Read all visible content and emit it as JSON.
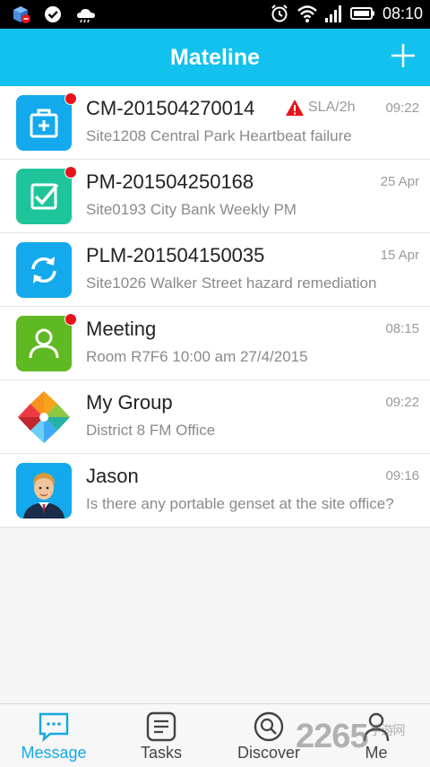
{
  "status_bar": {
    "time": "08:10"
  },
  "header": {
    "title": "Mateline",
    "add_icon": "plus-icon"
  },
  "conversations": [
    {
      "name": "CM-201504270014",
      "subtitle": "Site1208 Central Park Heartbeat failure",
      "time": "09:22",
      "sla": "SLA/2h",
      "unread": true,
      "icon": "toolbox-icon",
      "color": "#13a9ec"
    },
    {
      "name": "PM-201504250168",
      "subtitle": "Site0193 City Bank Weekly PM",
      "time": "25 Apr",
      "unread": true,
      "icon": "checkbox-icon",
      "color": "#1fc59a"
    },
    {
      "name": "PLM-201504150035",
      "subtitle": "Site1026 Walker Street hazard remediation",
      "time": "15 Apr",
      "unread": false,
      "icon": "refresh-icon",
      "color": "#13a9ec"
    },
    {
      "name": "Meeting",
      "subtitle": "Room R7F6  10:00  am  27/4/2015",
      "time": "08:15",
      "unread": true,
      "icon": "person-icon",
      "color": "#5fb922"
    },
    {
      "name": "My Group",
      "subtitle": "District 8 FM Office",
      "time": "09:22",
      "unread": false,
      "icon": "pinwheel-icon",
      "color": "#ffffff"
    },
    {
      "name": "Jason",
      "subtitle": "Is there any portable genset at the site office?",
      "time": "09:16",
      "unread": false,
      "icon": "user-avatar",
      "color": "#13a9ec"
    }
  ],
  "tabs": [
    {
      "label": "Message",
      "icon": "chat-bubble-icon",
      "active": true
    },
    {
      "label": "Tasks",
      "icon": "document-icon",
      "active": false
    },
    {
      "label": "Discover",
      "icon": "search-icon",
      "active": false
    },
    {
      "label": "Me",
      "icon": "person-icon",
      "active": false
    }
  ],
  "watermark": {
    "text": "2265",
    "suffix": "手游网"
  },
  "colors": {
    "accent": "#13c1ef",
    "unread_dot": "#e8131a",
    "sla_warning": "#e8131a"
  }
}
